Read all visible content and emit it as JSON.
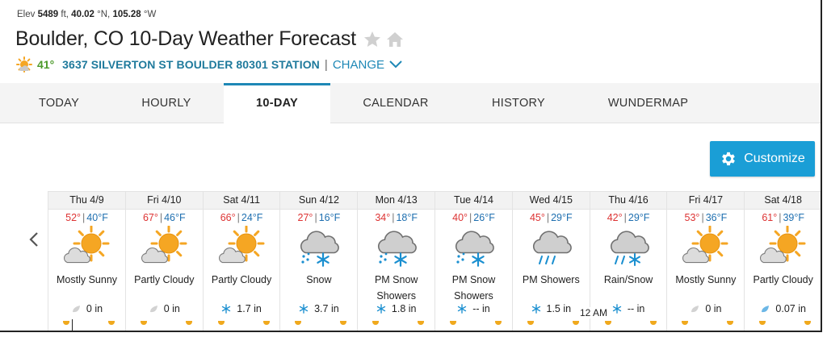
{
  "location": {
    "elev_label": "Elev",
    "elev_value": "5489",
    "elev_unit": "ft,",
    "lat_value": "40.02",
    "lat_unit": "°N,",
    "lon_value": "105.28",
    "lon_unit": "°W",
    "title": "Boulder, CO 10-Day Weather Forecast",
    "current_temp": "41°",
    "station": "3637 SILVERTON ST BOULDER 80301 STATION",
    "separator": "|",
    "change_label": "CHANGE"
  },
  "tabs": [
    {
      "label": "TODAY",
      "active": false
    },
    {
      "label": "HOURLY",
      "active": false
    },
    {
      "label": "10-DAY",
      "active": true
    },
    {
      "label": "CALENDAR",
      "active": false
    },
    {
      "label": "HISTORY",
      "active": false
    },
    {
      "label": "WUNDERMAP",
      "active": false
    }
  ],
  "customize_label": "Customize",
  "temp_separator": "|",
  "days": [
    {
      "date": "Thu 4/9",
      "hi": "52°",
      "lo": "40°F",
      "icon": "mostly-sunny-icon",
      "cond1": "Mostly Sunny",
      "cond2": "",
      "precip_icon": "rain-drop-gray-icon",
      "precip": "0 in"
    },
    {
      "date": "Fri 4/10",
      "hi": "67°",
      "lo": "46°F",
      "icon": "partly-cloudy-icon",
      "cond1": "Partly Cloudy",
      "cond2": "",
      "precip_icon": "rain-drop-gray-icon",
      "precip": "0 in"
    },
    {
      "date": "Sat 4/11",
      "hi": "66°",
      "lo": "24°F",
      "icon": "partly-cloudy-icon",
      "cond1": "Partly Cloudy",
      "cond2": "",
      "precip_icon": "snowflake-icon",
      "precip": "1.7 in"
    },
    {
      "date": "Sun 4/12",
      "hi": "27°",
      "lo": "16°F",
      "icon": "snow-icon",
      "cond1": "Snow",
      "cond2": "",
      "precip_icon": "snowflake-icon",
      "precip": "3.7 in"
    },
    {
      "date": "Mon 4/13",
      "hi": "34°",
      "lo": "18°F",
      "icon": "snow-showers-icon",
      "cond1": "PM Snow",
      "cond2": "Showers",
      "precip_icon": "snowflake-icon",
      "precip": "1.8 in"
    },
    {
      "date": "Tue 4/14",
      "hi": "40°",
      "lo": "26°F",
      "icon": "snow-showers-icon",
      "cond1": "PM Snow",
      "cond2": "Showers",
      "precip_icon": "snowflake-icon",
      "precip": "-- in"
    },
    {
      "date": "Wed 4/15",
      "hi": "45°",
      "lo": "29°F",
      "icon": "rain-showers-icon",
      "cond1": "PM Showers",
      "cond2": "",
      "precip_icon": "snowflake-icon",
      "precip": "1.5 in"
    },
    {
      "date": "Thu 4/16",
      "hi": "42°",
      "lo": "29°F",
      "icon": "rain-snow-icon",
      "cond1": "Rain/Snow",
      "cond2": "",
      "precip_icon": "snowflake-icon",
      "precip": "-- in"
    },
    {
      "date": "Fri 4/17",
      "hi": "53°",
      "lo": "36°F",
      "icon": "mostly-sunny-icon",
      "cond1": "Mostly Sunny",
      "cond2": "",
      "precip_icon": "rain-drop-gray-icon",
      "precip": "0 in"
    },
    {
      "date": "Sat 4/18",
      "hi": "61°",
      "lo": "39°F",
      "icon": "partly-cloudy-icon",
      "cond1": "Partly Cloudy",
      "cond2": "",
      "precip_icon": "rain-drop-blue-icon",
      "precip": "0.07 in"
    }
  ],
  "time_label": "12 AM",
  "colors": {
    "accent": "#1e88b6",
    "hi_temp": "#dd3333",
    "lo_temp": "#1e6fb0",
    "current_temp": "#4c9a2a",
    "sun": "#f5a623",
    "cloud": "#c9c9c9",
    "customize_bg": "#1a9ed6"
  }
}
